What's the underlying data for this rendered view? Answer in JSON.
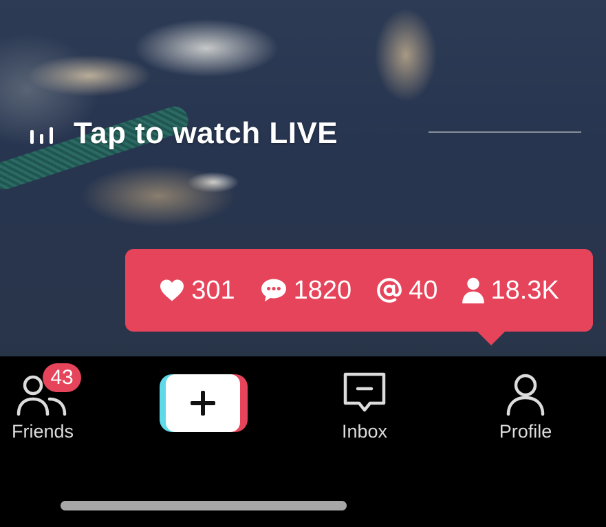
{
  "live": {
    "label": "Tap to watch LIVE",
    "icon": "live-bars-icon"
  },
  "stats": {
    "likes": "301",
    "comments": "1820",
    "mentions": "40",
    "followers": "18.3K",
    "bubble_color": "#e6445a"
  },
  "tabbar": {
    "friends": {
      "label": "Friends",
      "badge": "43",
      "icon": "friends-icon"
    },
    "create": {
      "icon": "plus-icon"
    },
    "inbox": {
      "label": "Inbox",
      "icon": "inbox-icon"
    },
    "profile": {
      "label": "Profile",
      "icon": "profile-icon"
    }
  },
  "colors": {
    "accent_red": "#e6445a",
    "accent_cyan": "#5fd9e8",
    "tab_text": "#dcdcdc"
  }
}
